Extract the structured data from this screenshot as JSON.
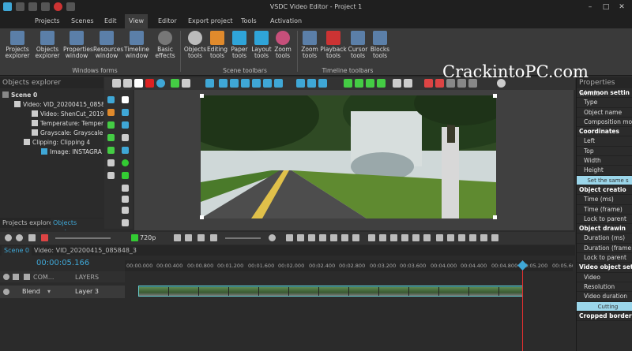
{
  "window": {
    "title": "VSDC Video Editor - Project 1",
    "min": "–",
    "max": "□",
    "close": "✕"
  },
  "menu": [
    "Projects",
    "Scenes",
    "Edit",
    "View",
    "Editor",
    "Export project",
    "Tools",
    "Activation"
  ],
  "ribbon": {
    "windows_forms": [
      "Projects explorer",
      "Objects explorer",
      "Properties window",
      "Resources window",
      "Timeline window",
      "Basic effects"
    ],
    "windows_forms_label": "Windows forms",
    "scene_toolbars": [
      "Objects tools",
      "Editing tools",
      "Paper tools",
      "Layout tools",
      "Zoom tools"
    ],
    "scene_toolbars_label": "Scene toolbars",
    "timeline_toolbars": [
      "Zoom tools",
      "Playback tools",
      "Cursor tools",
      "Blocks tools"
    ],
    "timeline_toolbars_label": "Timeline toolbars"
  },
  "watermark": "CrackintoPC.com",
  "objects_explorer": {
    "title": "Objects explorer",
    "items": [
      "Scene 0",
      "Video: VID_20200415_0858",
      "Video: ShenCut_20190",
      "Temperature: Temper",
      "Grayscale: Grayscale 1",
      "Clipping: Clipping 4",
      "Image: INSTAGRA"
    ]
  },
  "bottom_tabs": [
    "Projects explorer",
    "Objects explorer"
  ],
  "properties": {
    "title": "Properties windo",
    "rows": [
      {
        "t": "Common settin",
        "h": true
      },
      {
        "t": "Type"
      },
      {
        "t": "Object name"
      },
      {
        "t": "Composition mod"
      },
      {
        "t": "Coordinates",
        "h": true
      },
      {
        "t": "Left"
      },
      {
        "t": "Top"
      },
      {
        "t": "Width"
      },
      {
        "t": "Height"
      },
      {
        "t": "Set the same s",
        "b": true
      },
      {
        "t": "Object creatio",
        "h": true
      },
      {
        "t": "Time (ms)"
      },
      {
        "t": "Time (frame)"
      },
      {
        "t": "Lock to parent"
      },
      {
        "t": "Object drawin",
        "h": true
      },
      {
        "t": "Duration (ms)"
      },
      {
        "t": "Duration (frame"
      },
      {
        "t": "Lock to parent"
      },
      {
        "t": "Video object sett",
        "h": true
      },
      {
        "t": "Video"
      },
      {
        "t": "Resolution"
      },
      {
        "t": "Video duration"
      },
      {
        "t": "Cutting",
        "b": true
      },
      {
        "t": "Cropped border",
        "h": true
      }
    ]
  },
  "timeline": {
    "zoom": "720p",
    "scene_tab": "Scene 0",
    "clip_tab": "Video: VID_20200415_085848_3",
    "timecode": "00:00:05.166",
    "ticks": [
      "00:00.000",
      "00:00.400",
      "00:00.800",
      "00:01.200",
      "00:01.600",
      "00:02.000",
      "00:02.400",
      "00:02.800",
      "00:03.200",
      "00:03.600",
      "00:04.000",
      "00:04.400",
      "00:04.800",
      "00:05.200",
      "00:05.600"
    ],
    "com_label": "COM...",
    "layers_label": "LAYERS",
    "blend": "Blend",
    "layer": "Layer 3"
  },
  "colors": {
    "accent": "#3fa7d6",
    "playhead": "#e03030",
    "clip": "#2a6a70"
  }
}
